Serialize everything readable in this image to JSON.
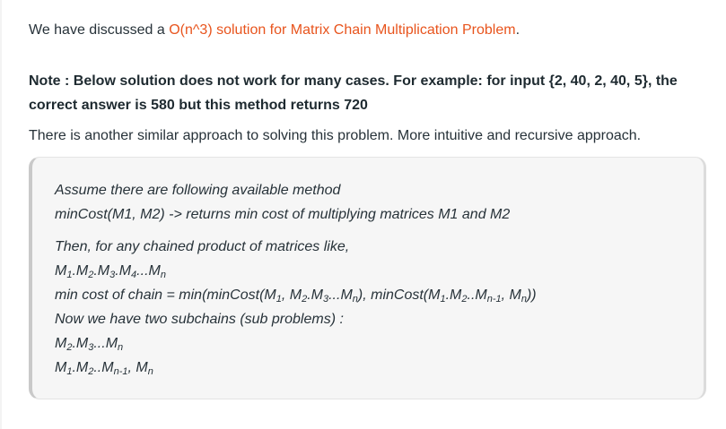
{
  "intro": {
    "before": "We have discussed a ",
    "link": "O(n^3) solution for Matrix Chain Multiplication Problem",
    "after": "."
  },
  "note": "Note : Below solution does not work for many cases. For example: for input {2, 40, 2, 40, 5}, the correct answer is 580 but this method returns 720",
  "approach": "There is another similar approach to solving this problem. More intuitive and recursive approach.",
  "quote": {
    "line1": "Assume there are following available method",
    "line2": "minCost(M1, M2) -> returns min cost of multiplying matrices M1 and M2",
    "line3": "Then, for any chained product of matrices like,",
    "line4": {
      "M": "M",
      "s1": "1",
      "dotM2": ".M",
      "s2": "2",
      "dotM3": ".M",
      "s3": "3",
      "dotM4": ".M",
      "s4": "4",
      "dots": "...M",
      "sn": "n"
    },
    "line5": {
      "a": "min cost of chain = min(minCost(M",
      "s1": "1",
      "b": ", M",
      "s2": "2",
      "c": ".M",
      "s3": "3",
      "d": "...M",
      "sn": "n",
      "e": "), minCost(M",
      "s1b": "1",
      "f": ".M",
      "s2b": "2",
      "g": "..M",
      "snm1": "n-1",
      "h": ", M",
      "snb": "n",
      "i": "))"
    },
    "line6": "Now we have two subchains (sub problems) :",
    "line7": {
      "a": "M",
      "s2": "2",
      "b": ".M",
      "s3": "3",
      "c": "...M",
      "sn": "n"
    },
    "line8": {
      "a": "M",
      "s1": "1",
      "b": ".M",
      "s2": "2",
      "c": "..M",
      "snm1": "n-1",
      "d": ", M",
      "sn": "n"
    }
  }
}
